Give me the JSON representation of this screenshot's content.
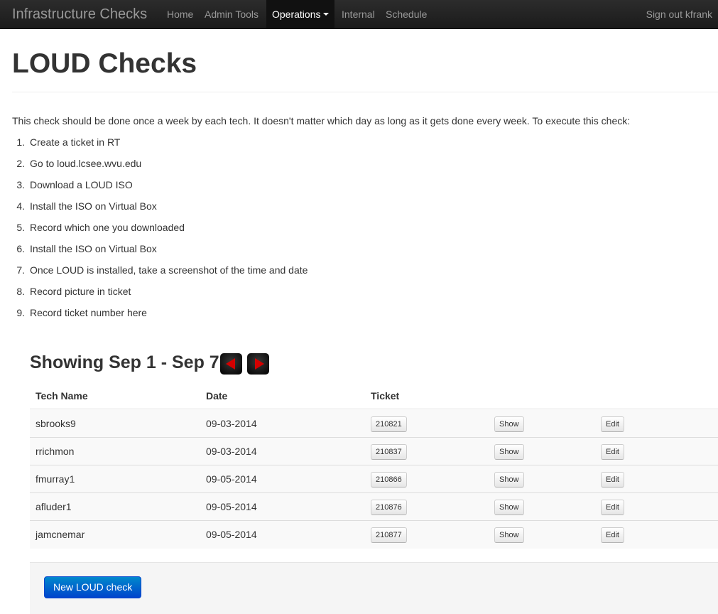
{
  "nav": {
    "brand": "Infrastructure Checks",
    "items": [
      {
        "label": "Home"
      },
      {
        "label": "Admin Tools"
      },
      {
        "label": "Operations"
      },
      {
        "label": "Internal"
      },
      {
        "label": "Schedule"
      }
    ],
    "sign_out": "Sign out kfrank"
  },
  "page": {
    "title": "LOUD Checks",
    "intro": "This check should be done once a week by each tech. It doesn't matter which day as long as it gets done every week. To execute this check:",
    "steps": [
      {
        "num": "1.",
        "text": "Create a ticket in RT"
      },
      {
        "num": "2.",
        "text": "Go to loud.lcsee.wvu.edu"
      },
      {
        "num": "3.",
        "text": "Download a LOUD ISO"
      },
      {
        "num": "4.",
        "text": "Install the ISO on Virtual Box"
      },
      {
        "num": "5.",
        "text": "Record which one you downloaded"
      },
      {
        "num": "6.",
        "text": "Install the ISO on Virtual Box"
      },
      {
        "num": "7.",
        "text": "Once LOUD is installed, take a screenshot of the time and date"
      },
      {
        "num": "8.",
        "text": "Record picture in ticket"
      },
      {
        "num": "9.",
        "text": "Record ticket number here"
      }
    ]
  },
  "week": {
    "heading": "Showing Sep 1 - Sep 7",
    "prev_icon": "arrow-left-icon",
    "next_icon": "arrow-right-icon",
    "arrow_color": "#d40000"
  },
  "table": {
    "headers": {
      "tech": "Tech Name",
      "date": "Date",
      "ticket": "Ticket"
    },
    "show_label": "Show",
    "edit_label": "Edit",
    "rows": [
      {
        "tech": "sbrooks9",
        "date": "09-03-2014",
        "ticket": "210821"
      },
      {
        "tech": "rrichmon",
        "date": "09-03-2014",
        "ticket": "210837"
      },
      {
        "tech": "fmurray1",
        "date": "09-05-2014",
        "ticket": "210866"
      },
      {
        "tech": "afluder1",
        "date": "09-05-2014",
        "ticket": "210876"
      },
      {
        "tech": "jamcnemar",
        "date": "09-05-2014",
        "ticket": "210877"
      }
    ]
  },
  "actions": {
    "new_check": "New LOUD check"
  }
}
